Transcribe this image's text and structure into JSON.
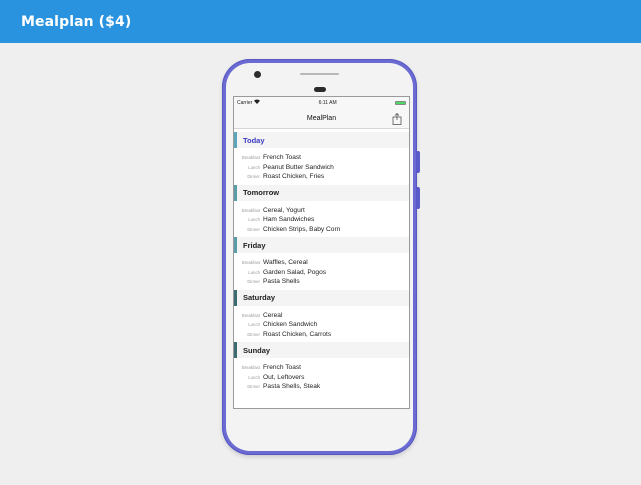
{
  "header": {
    "title": "Mealplan ($4)"
  },
  "statusbar": {
    "carrier": "Carrier",
    "wifi_icon": "wifi-icon",
    "time": "6:11 AM",
    "battery_icon": "battery-icon"
  },
  "navbar": {
    "title": "MealPlan",
    "share_icon": "share-icon"
  },
  "meal_labels": {
    "breakfast": "Breakfast",
    "lunch": "Lunch",
    "dinner": "Dinner"
  },
  "days": [
    {
      "name": "Today",
      "breakfast": "French Toast",
      "lunch": "Peanut Butter Sandwich",
      "dinner": "Roast Chicken, Fries"
    },
    {
      "name": "Tomorrow",
      "breakfast": "Cereal, Yogurt",
      "lunch": "Ham Sandwiches",
      "dinner": "Chicken Strips, Baby Corn"
    },
    {
      "name": "Friday",
      "breakfast": "Waffles, Cereal",
      "lunch": "Garden Salad, Pogos",
      "dinner": "Pasta Shells"
    },
    {
      "name": "Saturday",
      "breakfast": "Cereal",
      "lunch": "Chicken Sandwich",
      "dinner": "Roast Chicken, Carrots"
    },
    {
      "name": "Sunday",
      "breakfast": "French Toast",
      "lunch": "Out, Leftovers",
      "dinner": "Pasta Shells, Steak"
    }
  ],
  "colors": {
    "header_bg": "#2a93df",
    "phone_frame": "#6a6ad2",
    "today_text": "#3a3ac2",
    "section_accent": "#5b9da6"
  }
}
